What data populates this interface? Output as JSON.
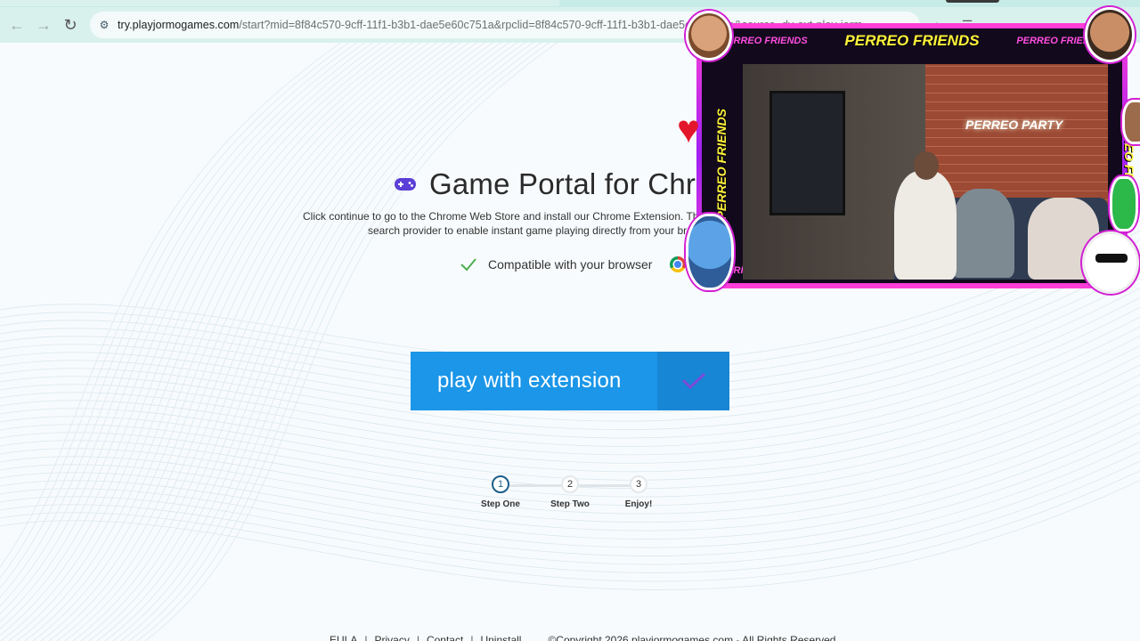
{
  "browser": {
    "url_domain": "try.playjormogames.com",
    "url_rest": "/start?mid=8f84c570-9cff-11f1-b3b1-dae5e60c751a&rpclid=8f84c570-9cff-11f1-b3b1-dae5e60c751a&source=dy-ext-play-jorm"
  },
  "hero": {
    "title": "Game Portal for Chrome",
    "desc_line1": "Click continue to go to the Chrome Web Store and install our Chrome Extension. This extension changes your",
    "desc_line2": "search provider to enable instant game playing directly from your browser's",
    "compat": "Compatible with your browser"
  },
  "cta": {
    "label": "play with extension"
  },
  "steps": [
    {
      "num": "1",
      "label": "Step One"
    },
    {
      "num": "2",
      "label": "Step Two"
    },
    {
      "num": "3",
      "label": "Enjoy!"
    }
  ],
  "footer": {
    "eula": "EULA",
    "privacy": "Privacy",
    "contact": "Contact",
    "uninstall": "Uninstall",
    "copyright": "©Copyright 2026 playjormogames.com - All Rights Reserved"
  },
  "overlay": {
    "banner_big": "PERREO FRIENDS",
    "banner_small": "PERREO FRIENDS",
    "side_text": "PERREO FRIENDS",
    "sign": "PERREO PARTY"
  },
  "colors": {
    "cta": "#1b96e8",
    "cta_side": "#1786d4",
    "check": "#4caf50",
    "gamepad": "#5b3fd6",
    "toolbar": "#d9f1ed"
  }
}
